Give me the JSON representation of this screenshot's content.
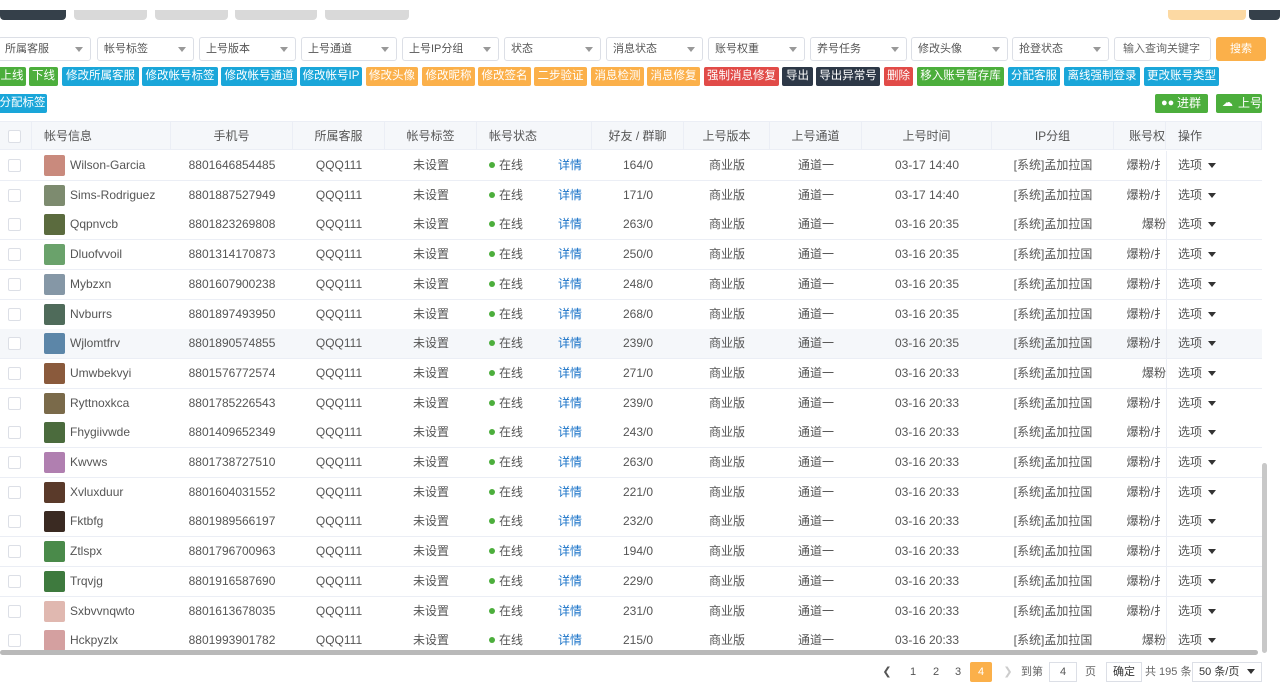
{
  "filters": {
    "customer": "所属客服",
    "tag": "帐号标签",
    "version": "上号版本",
    "channel": "上号通道",
    "ip_group": "上号IP分组",
    "status": "状态",
    "msg_status": "消息状态",
    "weight": "账号权重",
    "task": "养号任务",
    "avatar": "修改头像",
    "login_status": "抢登状态",
    "search_placeholder": "输入查询关键字",
    "search_button": "搜索"
  },
  "actions": {
    "online": "上线",
    "offline": "下线",
    "edit_customer": "修改所属客服",
    "edit_tag": "修改帐号标签",
    "edit_channel": "修改帐号通道",
    "edit_ip": "修改帐号IP",
    "edit_avatar": "修改头像",
    "edit_nickname": "修改昵称",
    "edit_signature": "修改签名",
    "two_step": "二步验证",
    "msg_check": "消息检测",
    "msg_repair": "消息修复",
    "force_repair": "强制消息修复",
    "export": "导出",
    "export_abnormal": "导出异常号",
    "delete": "删除",
    "move_storage": "移入账号暂存库",
    "assign_customer": "分配客服",
    "offline_force": "离线强制登录",
    "change_type": "更改账号类型",
    "assign_tag": "分配标签",
    "join_group": "进群",
    "upload": "上号"
  },
  "table": {
    "headers": [
      "帐号信息",
      "手机号",
      "所属客服",
      "帐号标签",
      "帐号状态",
      "好友 / 群聊",
      "上号版本",
      "上号通道",
      "上号时间",
      "IP分组",
      "账号权",
      "操作"
    ],
    "rows": [
      {
        "name": "Wilson-Garcia",
        "phone": "8801646854485",
        "customer": "QQQ111",
        "tag": "未设置",
        "status": "在线",
        "detail": "详情",
        "friends": "164/0",
        "version": "商业版",
        "channel": "通道一",
        "time": "03-17 14:40",
        "ip": "[系统]孟加拉国",
        "weight": "爆粉/扌",
        "op": "选项",
        "color": "#c98a7d"
      },
      {
        "name": "Sims-Rodriguez",
        "phone": "8801887527949",
        "customer": "QQQ111",
        "tag": "未设置",
        "status": "在线",
        "detail": "详情",
        "friends": "171/0",
        "version": "商业版",
        "channel": "通道一",
        "time": "03-17 14:40",
        "ip": "[系统]孟加拉国",
        "weight": "爆粉/扌",
        "op": "选项",
        "color": "#7d8b6f"
      },
      {
        "name": "Qqpnvcb",
        "phone": "8801823269808",
        "customer": "QQQ111",
        "tag": "未设置",
        "status": "在线",
        "detail": "详情",
        "friends": "263/0",
        "version": "商业版",
        "channel": "通道一",
        "time": "03-16 20:35",
        "ip": "[系统]孟加拉国",
        "weight": "爆粉",
        "op": "选项",
        "color": "#5b6b3e"
      },
      {
        "name": "Dluofvvoil",
        "phone": "8801314170873",
        "customer": "QQQ111",
        "tag": "未设置",
        "status": "在线",
        "detail": "详情",
        "friends": "250/0",
        "version": "商业版",
        "channel": "通道一",
        "time": "03-16 20:35",
        "ip": "[系统]孟加拉国",
        "weight": "爆粉/扌",
        "op": "选项",
        "color": "#6aa26b"
      },
      {
        "name": "Mybzxn",
        "phone": "8801607900238",
        "customer": "QQQ111",
        "tag": "未设置",
        "status": "在线",
        "detail": "详情",
        "friends": "248/0",
        "version": "商业版",
        "channel": "通道一",
        "time": "03-16 20:35",
        "ip": "[系统]孟加拉国",
        "weight": "爆粉/扌",
        "op": "选项",
        "color": "#8597a6"
      },
      {
        "name": "Nvburrs",
        "phone": "8801897493950",
        "customer": "QQQ111",
        "tag": "未设置",
        "status": "在线",
        "detail": "详情",
        "friends": "268/0",
        "version": "商业版",
        "channel": "通道一",
        "time": "03-16 20:35",
        "ip": "[系统]孟加拉国",
        "weight": "爆粉/扌",
        "op": "选项",
        "color": "#4f6b5a"
      },
      {
        "name": "Wjlomtfrv",
        "phone": "8801890574855",
        "customer": "QQQ111",
        "tag": "未设置",
        "status": "在线",
        "detail": "详情",
        "friends": "239/0",
        "version": "商业版",
        "channel": "通道一",
        "time": "03-16 20:35",
        "ip": "[系统]孟加拉国",
        "weight": "爆粉/扌",
        "op": "选项",
        "color": "#5c86a8"
      },
      {
        "name": "Umwbekvyi",
        "phone": "8801576772574",
        "customer": "QQQ111",
        "tag": "未设置",
        "status": "在线",
        "detail": "详情",
        "friends": "271/0",
        "version": "商业版",
        "channel": "通道一",
        "time": "03-16 20:33",
        "ip": "[系统]孟加拉国",
        "weight": "爆粉",
        "op": "选项",
        "color": "#8a5a3c"
      },
      {
        "name": "Ryttnoxkca",
        "phone": "8801785226543",
        "customer": "QQQ111",
        "tag": "未设置",
        "status": "在线",
        "detail": "详情",
        "friends": "239/0",
        "version": "商业版",
        "channel": "通道一",
        "time": "03-16 20:33",
        "ip": "[系统]孟加拉国",
        "weight": "爆粉/扌",
        "op": "选项",
        "color": "#7a6a4a"
      },
      {
        "name": "Fhygiivwde",
        "phone": "8801409652349",
        "customer": "QQQ111",
        "tag": "未设置",
        "status": "在线",
        "detail": "详情",
        "friends": "243/0",
        "version": "商业版",
        "channel": "通道一",
        "time": "03-16 20:33",
        "ip": "[系统]孟加拉国",
        "weight": "爆粉/扌",
        "op": "选项",
        "color": "#4b6b3d"
      },
      {
        "name": "Kwvws",
        "phone": "8801738727510",
        "customer": "QQQ111",
        "tag": "未设置",
        "status": "在线",
        "detail": "详情",
        "friends": "263/0",
        "version": "商业版",
        "channel": "通道一",
        "time": "03-16 20:33",
        "ip": "[系统]孟加拉国",
        "weight": "爆粉/扌",
        "op": "选项",
        "color": "#b07fb0"
      },
      {
        "name": "Xvluxduur",
        "phone": "8801604031552",
        "customer": "QQQ111",
        "tag": "未设置",
        "status": "在线",
        "detail": "详情",
        "friends": "221/0",
        "version": "商业版",
        "channel": "通道一",
        "time": "03-16 20:33",
        "ip": "[系统]孟加拉国",
        "weight": "爆粉/扌",
        "op": "选项",
        "color": "#5a3a2a"
      },
      {
        "name": "Fktbfg",
        "phone": "8801989566197",
        "customer": "QQQ111",
        "tag": "未设置",
        "status": "在线",
        "detail": "详情",
        "friends": "232/0",
        "version": "商业版",
        "channel": "通道一",
        "time": "03-16 20:33",
        "ip": "[系统]孟加拉国",
        "weight": "爆粉/扌",
        "op": "选项",
        "color": "#3a2a22"
      },
      {
        "name": "Ztlspx",
        "phone": "8801796700963",
        "customer": "QQQ111",
        "tag": "未设置",
        "status": "在线",
        "detail": "详情",
        "friends": "194/0",
        "version": "商业版",
        "channel": "通道一",
        "time": "03-16 20:33",
        "ip": "[系统]孟加拉国",
        "weight": "爆粉/扌",
        "op": "选项",
        "color": "#4a8a4a"
      },
      {
        "name": "Trqvjg",
        "phone": "8801916587690",
        "customer": "QQQ111",
        "tag": "未设置",
        "status": "在线",
        "detail": "详情",
        "friends": "229/0",
        "version": "商业版",
        "channel": "通道一",
        "time": "03-16 20:33",
        "ip": "[系统]孟加拉国",
        "weight": "爆粉/扌",
        "op": "选项",
        "color": "#3e7a3e"
      },
      {
        "name": "Sxbvvnqwto",
        "phone": "8801613678035",
        "customer": "QQQ111",
        "tag": "未设置",
        "status": "在线",
        "detail": "详情",
        "friends": "231/0",
        "version": "商业版",
        "channel": "通道一",
        "time": "03-16 20:33",
        "ip": "[系统]孟加拉国",
        "weight": "爆粉/扌",
        "op": "选项",
        "color": "#e0b8b0"
      },
      {
        "name": "Hckpyzlx",
        "phone": "8801993901782",
        "customer": "QQQ111",
        "tag": "未设置",
        "status": "在线",
        "detail": "详情",
        "friends": "215/0",
        "version": "商业版",
        "channel": "通道一",
        "time": "03-16 20:33",
        "ip": "[系统]孟加拉国",
        "weight": "爆粉",
        "op": "选项",
        "color": "#d4a0a0"
      }
    ]
  },
  "pagination": {
    "pages": [
      "1",
      "2",
      "3",
      "4"
    ],
    "goto_label": "到第",
    "goto_value": "4",
    "page_unit": "页",
    "confirm": "确定",
    "total": "共 195 条",
    "per_page": "50 条/页"
  },
  "colors": {
    "accent": "#fbb04a",
    "green": "#4cae3c",
    "blue": "#1aa6d9",
    "red": "#e14b48",
    "dark": "#2d3847"
  }
}
